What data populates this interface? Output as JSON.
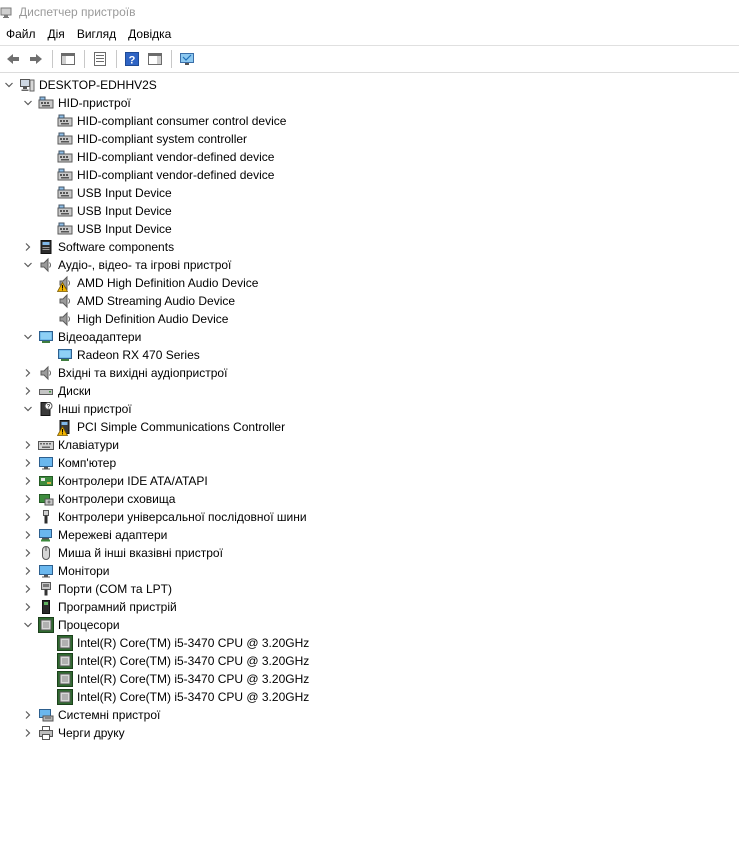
{
  "window": {
    "title": "Диспетчер пристроїв"
  },
  "menu": [
    "Файл",
    "Дія",
    "Вигляд",
    "Довідка"
  ],
  "toolbar": [
    {
      "name": "back-button",
      "icon": "arrow-left-icon"
    },
    {
      "name": "forward-button",
      "icon": "arrow-right-icon"
    },
    {
      "sep": true
    },
    {
      "name": "show-hide-console-tree-button",
      "icon": "console-tree-icon"
    },
    {
      "sep": true
    },
    {
      "name": "properties-button",
      "icon": "properties-icon"
    },
    {
      "sep": true
    },
    {
      "name": "help-button",
      "icon": "help-icon"
    },
    {
      "name": "action-pane-button",
      "icon": "action-pane-icon"
    },
    {
      "sep": true
    },
    {
      "name": "monitor-scan-button",
      "icon": "monitor-icon"
    }
  ],
  "tree": [
    {
      "label": "DESKTOP-EDHHV2S",
      "level": 0,
      "exp": "open",
      "icon": "computer"
    },
    {
      "label": "HID-пристрої",
      "level": 1,
      "exp": "open",
      "icon": "hid"
    },
    {
      "label": "HID-compliant consumer control device",
      "level": 2,
      "exp": "none",
      "icon": "hid"
    },
    {
      "label": "HID-compliant system controller",
      "level": 2,
      "exp": "none",
      "icon": "hid"
    },
    {
      "label": "HID-compliant vendor-defined device",
      "level": 2,
      "exp": "none",
      "icon": "hid"
    },
    {
      "label": "HID-compliant vendor-defined device",
      "level": 2,
      "exp": "none",
      "icon": "hid"
    },
    {
      "label": "USB Input Device",
      "level": 2,
      "exp": "none",
      "icon": "hid"
    },
    {
      "label": "USB Input Device",
      "level": 2,
      "exp": "none",
      "icon": "hid"
    },
    {
      "label": "USB Input Device",
      "level": 2,
      "exp": "none",
      "icon": "hid"
    },
    {
      "label": "Software components",
      "level": 1,
      "exp": "closed",
      "icon": "software"
    },
    {
      "label": "Аудіо-, відео- та ігрові пристрої",
      "level": 1,
      "exp": "open",
      "icon": "speaker"
    },
    {
      "label": "AMD High Definition Audio Device",
      "level": 2,
      "exp": "none",
      "icon": "speaker",
      "warn": true
    },
    {
      "label": "AMD Streaming Audio Device",
      "level": 2,
      "exp": "none",
      "icon": "speaker"
    },
    {
      "label": "High Definition Audio Device",
      "level": 2,
      "exp": "none",
      "icon": "speaker"
    },
    {
      "label": "Відеоадаптери",
      "level": 1,
      "exp": "open",
      "icon": "display"
    },
    {
      "label": "Radeon RX 470 Series",
      "level": 2,
      "exp": "none",
      "icon": "display"
    },
    {
      "label": "Вхідні та вихідні аудіопристрої",
      "level": 1,
      "exp": "closed",
      "icon": "speaker"
    },
    {
      "label": "Диски",
      "level": 1,
      "exp": "closed",
      "icon": "disk"
    },
    {
      "label": "Інші пристрої",
      "level": 1,
      "exp": "open",
      "icon": "other"
    },
    {
      "label": "PCI Simple Communications Controller",
      "level": 2,
      "exp": "none",
      "icon": "pci",
      "warn": true
    },
    {
      "label": "Клавіатури",
      "level": 1,
      "exp": "closed",
      "icon": "keyboard"
    },
    {
      "label": "Комп'ютер",
      "level": 1,
      "exp": "closed",
      "icon": "monitor"
    },
    {
      "label": "Контролери IDE ATA/ATAPI",
      "level": 1,
      "exp": "closed",
      "icon": "ide"
    },
    {
      "label": "Контролери сховища",
      "level": 1,
      "exp": "closed",
      "icon": "storage"
    },
    {
      "label": "Контролери універсальної послідовної шини",
      "level": 1,
      "exp": "closed",
      "icon": "usb"
    },
    {
      "label": "Мережеві адаптери",
      "level": 1,
      "exp": "closed",
      "icon": "network"
    },
    {
      "label": "Миша й інші вказівні пристрої",
      "level": 1,
      "exp": "closed",
      "icon": "mouse"
    },
    {
      "label": "Монітори",
      "level": 1,
      "exp": "closed",
      "icon": "monitor"
    },
    {
      "label": "Порти (COM та LPT)",
      "level": 1,
      "exp": "closed",
      "icon": "port"
    },
    {
      "label": "Програмний пристрій",
      "level": 1,
      "exp": "closed",
      "icon": "softdevice"
    },
    {
      "label": "Процесори",
      "level": 1,
      "exp": "open",
      "icon": "cpu"
    },
    {
      "label": "Intel(R) Core(TM) i5-3470 CPU @ 3.20GHz",
      "level": 2,
      "exp": "none",
      "icon": "cpu"
    },
    {
      "label": "Intel(R) Core(TM) i5-3470 CPU @ 3.20GHz",
      "level": 2,
      "exp": "none",
      "icon": "cpu"
    },
    {
      "label": "Intel(R) Core(TM) i5-3470 CPU @ 3.20GHz",
      "level": 2,
      "exp": "none",
      "icon": "cpu"
    },
    {
      "label": "Intel(R) Core(TM) i5-3470 CPU @ 3.20GHz",
      "level": 2,
      "exp": "none",
      "icon": "cpu"
    },
    {
      "label": "Системні пристрої",
      "level": 1,
      "exp": "closed",
      "icon": "system"
    },
    {
      "label": "Черги друку",
      "level": 1,
      "exp": "closed",
      "icon": "printer"
    }
  ],
  "colors": {
    "accent": "#3a7bd5",
    "chevron": "#5a5a5a",
    "warn": "#f2b400"
  }
}
